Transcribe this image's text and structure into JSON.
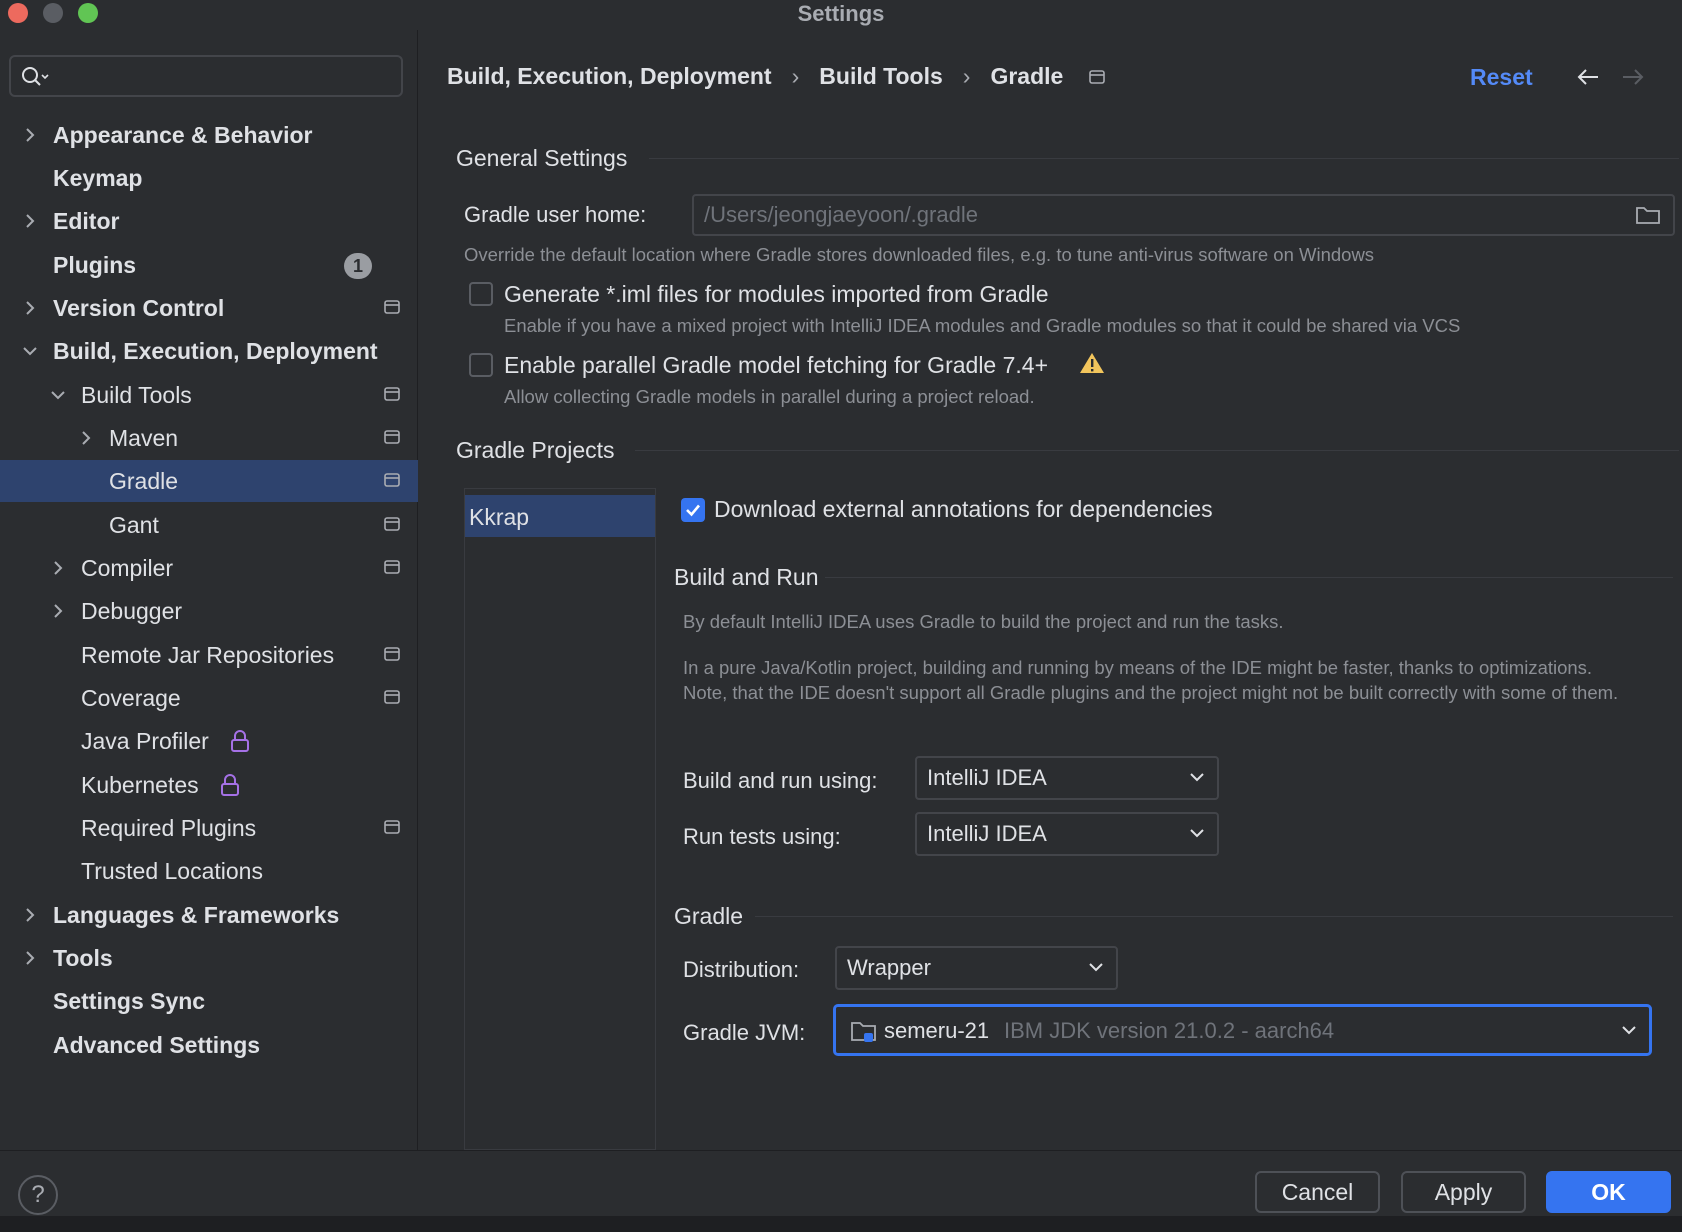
{
  "window": {
    "title": "Settings"
  },
  "search": {
    "placeholder": "",
    "value": ""
  },
  "sidebar": {
    "items": [
      {
        "label": "Appearance & Behavior",
        "badge": ""
      },
      {
        "label": "Keymap"
      },
      {
        "label": "Editor"
      },
      {
        "label": "Plugins",
        "badge": "1"
      },
      {
        "label": "Version Control"
      },
      {
        "label": "Build, Execution, Deployment"
      },
      {
        "label": "Build Tools"
      },
      {
        "label": "Maven"
      },
      {
        "label": "Gradle"
      },
      {
        "label": "Gant"
      },
      {
        "label": "Compiler"
      },
      {
        "label": "Debugger"
      },
      {
        "label": "Remote Jar Repositories"
      },
      {
        "label": "Coverage"
      },
      {
        "label": "Java Profiler"
      },
      {
        "label": "Kubernetes"
      },
      {
        "label": "Required Plugins"
      },
      {
        "label": "Trusted Locations"
      },
      {
        "label": "Languages & Frameworks"
      },
      {
        "label": "Tools"
      },
      {
        "label": "Settings Sync"
      },
      {
        "label": "Advanced Settings"
      }
    ]
  },
  "header": {
    "breadcrumb": [
      "Build, Execution, Deployment",
      "Build Tools",
      "Gradle"
    ],
    "separator": "›",
    "reset_label": "Reset"
  },
  "general": {
    "title": "General Settings",
    "user_home_label": "Gradle user home:",
    "user_home_value": "/Users/jeongjaeyoon/.gradle",
    "user_home_hint": "Override the default location where Gradle stores downloaded files, e.g. to tune anti-virus software on Windows",
    "iml_label": "Generate *.iml files for modules imported from Gradle",
    "iml_hint": "Enable if you have a mixed project with IntelliJ IDEA modules and Gradle modules so that it could be shared via VCS",
    "parallel_label": "Enable parallel Gradle model fetching for Gradle 7.4+",
    "parallel_hint": "Allow collecting Gradle models in parallel during a project reload."
  },
  "projects": {
    "title": "Gradle Projects",
    "list": [
      "Kkrap"
    ],
    "download_annotations_label": "Download external annotations for dependencies",
    "build_run": {
      "title": "Build and Run",
      "hint1": "By default IntelliJ IDEA uses Gradle to build the project and run the tasks.",
      "hint2": "In a pure Java/Kotlin project, building and running by means of the IDE might be faster, thanks to optimizations. Note, that the IDE doesn't support all Gradle plugins and the project might not be built correctly with some of them.",
      "build_using_label": "Build and run using:",
      "build_using_value": "IntelliJ IDEA",
      "tests_using_label": "Run tests using:",
      "tests_using_value": "IntelliJ IDEA"
    },
    "gradle": {
      "title": "Gradle",
      "distribution_label": "Distribution:",
      "distribution_value": "Wrapper",
      "jvm_label": "Gradle JVM:",
      "jvm_name": "semeru-21",
      "jvm_detail": "IBM JDK version 21.0.2 - aarch64"
    }
  },
  "footer": {
    "help_label": "?",
    "cancel_label": "Cancel",
    "apply_label": "Apply",
    "ok_label": "OK"
  },
  "colors": {
    "background": "#2b2d30",
    "selection": "#2e436e",
    "accent": "#3574f0",
    "link": "#548af7",
    "warning": "#f2c55c",
    "lock": "#a571e6"
  }
}
